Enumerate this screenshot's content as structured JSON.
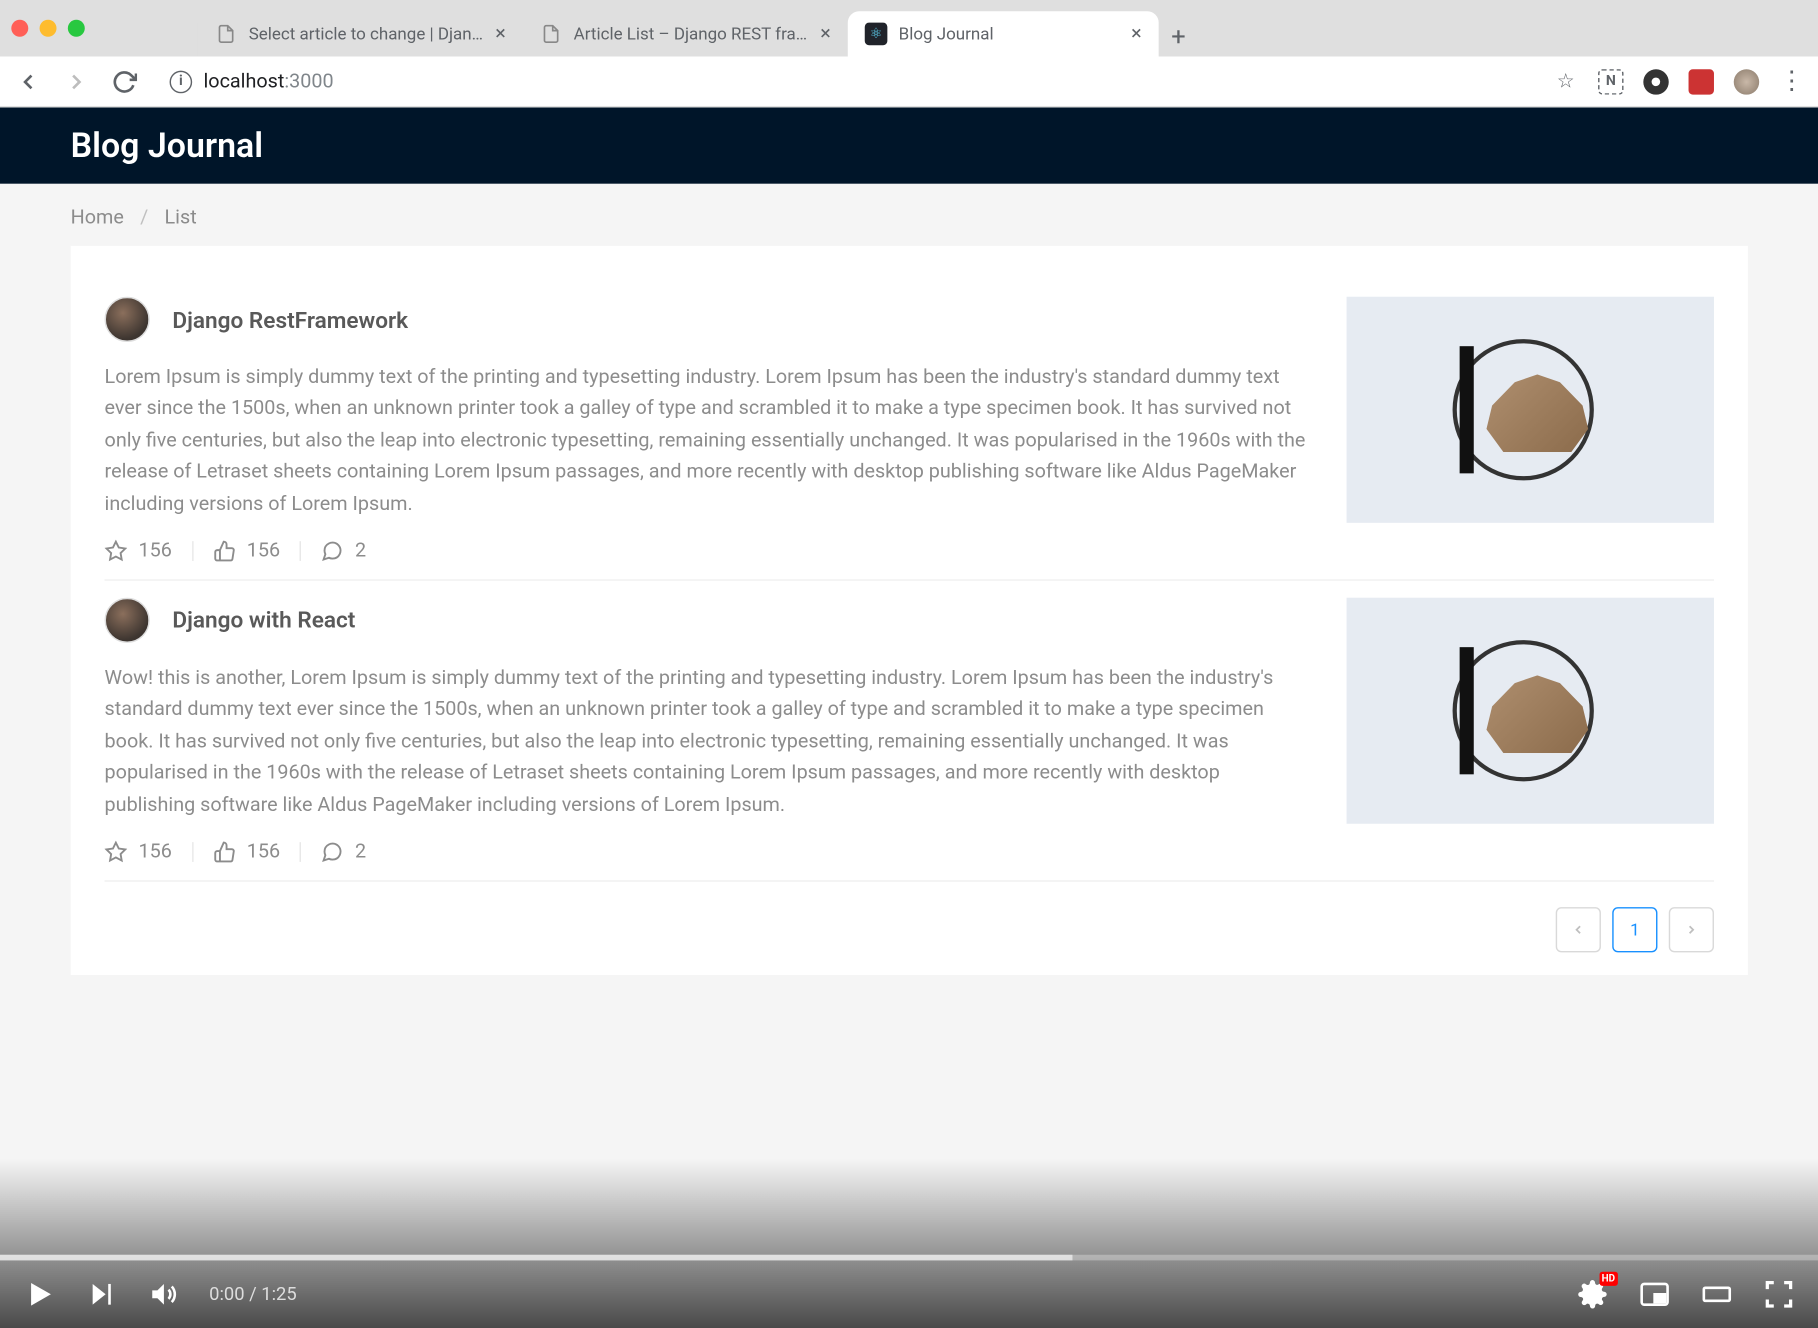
{
  "browser": {
    "tabs": [
      {
        "title": "Select article to change | Django",
        "active": false
      },
      {
        "title": "Article List – Django REST framework",
        "active": false
      },
      {
        "title": "Blog Journal",
        "active": true
      }
    ],
    "url_host": "localhost",
    "url_port": ":3000"
  },
  "app": {
    "title": "Blog Journal",
    "breadcrumb": {
      "home": "Home",
      "current": "List",
      "sep": "/"
    }
  },
  "articles": [
    {
      "title": "Django RestFramework",
      "body": "Lorem Ipsum is simply dummy text of the printing and typesetting industry. Lorem Ipsum has been the industry's standard dummy text ever since the 1500s, when an unknown printer took a galley of type and scrambled it to make a type specimen book. It has survived not only five centuries, but also the leap into electronic typesetting, remaining essentially unchanged. It was popularised in the 1960s with the release of Letraset sheets containing Lorem Ipsum passages, and more recently with desktop publishing software like Aldus PageMaker including versions of Lorem Ipsum.",
      "stars": "156",
      "likes": "156",
      "comments": "2"
    },
    {
      "title": "Django with React",
      "body": "Wow! this is another, Lorem Ipsum is simply dummy text of the printing and typesetting industry. Lorem Ipsum has been the industry's standard dummy text ever since the 1500s, when an unknown printer took a galley of type and scrambled it to make a type specimen book. It has survived not only five centuries, but also the leap into electronic typesetting, remaining essentially unchanged. It was popularised in the 1960s with the release of Letraset sheets containing Lorem Ipsum passages, and more recently with desktop publishing software like Aldus PageMaker including versions of Lorem Ipsum.",
      "stars": "156",
      "likes": "156",
      "comments": "2"
    }
  ],
  "pagination": {
    "current": "1"
  },
  "video": {
    "current_time": "0:00",
    "duration": "1:25",
    "time_sep": " / ",
    "hd": "HD"
  }
}
